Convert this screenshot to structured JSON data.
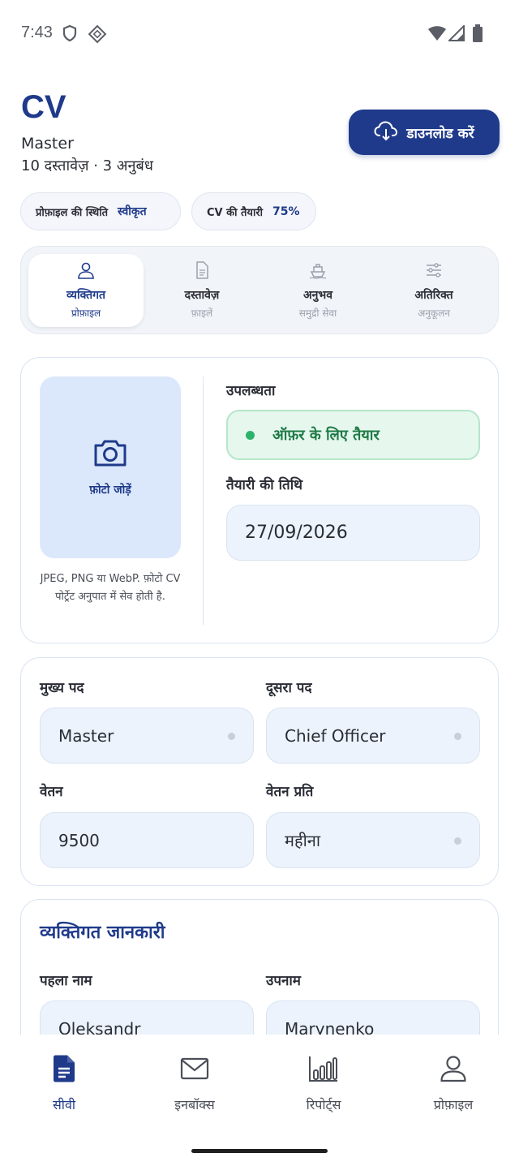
{
  "status_bar": {
    "time": "7:43",
    "icons": [
      "shield-icon",
      "vpn-key-icon",
      "wifi-icon",
      "signal-icon",
      "battery-icon"
    ]
  },
  "header": {
    "title": "CV",
    "rank": "Master",
    "meta": "10 दस्तावेज़ · 3 अनुबंध",
    "download_label": "डाउनलोड करें"
  },
  "chips": [
    {
      "label": "प्रोफ़ाइल की स्थिति",
      "value": "स्वीकृत"
    },
    {
      "label": "CV की तैयारी",
      "value": "75%"
    }
  ],
  "tabs": [
    {
      "title": "व्यक्तिगत",
      "sub": "प्रोफ़ाइल",
      "icon": "person-icon",
      "active": true
    },
    {
      "title": "दस्तावेज़",
      "sub": "फ़ाइलें",
      "icon": "document-icon",
      "active": false
    },
    {
      "title": "अनुभव",
      "sub": "समुद्री सेवा",
      "icon": "ship-icon",
      "active": false
    },
    {
      "title": "अतिरिक्त",
      "sub": "अनुकूलन",
      "icon": "sliders-icon",
      "active": false
    }
  ],
  "photo": {
    "add_label": "फ़ोटो जोड़ें",
    "hint": "JPEG, PNG या WebP. फ़ोटो CV पोर्ट्रेट अनुपात में सेव होती है."
  },
  "availability": {
    "label": "उपलब्धता",
    "value": "ऑफ़र के लिए तैयार",
    "ready_date_label": "तैयारी की तिथि",
    "ready_date": "27/09/2026"
  },
  "position": {
    "main_label": "मुख्य पद",
    "main_value": "Master",
    "second_label": "दूसरा पद",
    "second_value": "Chief Officer",
    "salary_label": "वेतन",
    "salary_value": "9500",
    "per_label": "वेतन प्रति",
    "per_value": "महीना"
  },
  "personal": {
    "section_title": "व्यक्तिगत जानकारी",
    "first_name_label": "पहला नाम",
    "first_name": "Oleksandr",
    "surname_label": "उपनाम",
    "surname": "Marynenko"
  },
  "bottom_nav": [
    {
      "label": "सीवी",
      "icon": "cv-document-icon",
      "active": true
    },
    {
      "label": "इनबॉक्स",
      "icon": "mail-icon",
      "active": false
    },
    {
      "label": "रिपोर्ट्स",
      "icon": "bar-chart-icon",
      "active": false
    },
    {
      "label": "प्रोफ़ाइल",
      "icon": "person-icon",
      "active": false
    }
  ],
  "colors": {
    "primary": "#1f3a8a",
    "available": "#1e7a45",
    "field_bg": "#edf3fc"
  }
}
